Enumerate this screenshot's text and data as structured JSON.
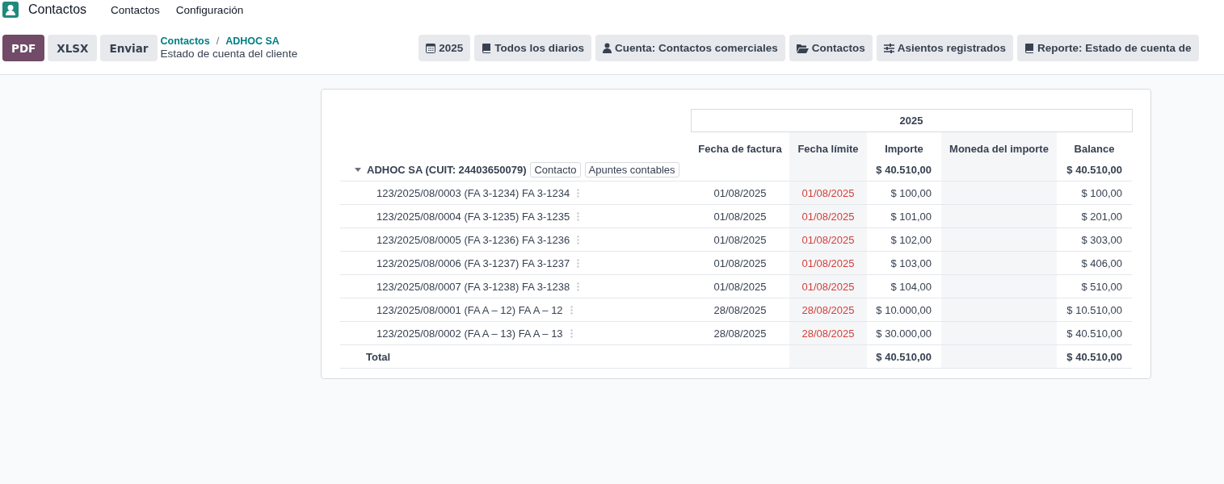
{
  "nav": {
    "app_name": "Contactos",
    "menu": [
      "Contactos",
      "Configuración"
    ]
  },
  "actions": [
    {
      "label": "PDF",
      "kind": "primary"
    },
    {
      "label": "XLSX",
      "kind": "secondary"
    },
    {
      "label": "Enviar",
      "kind": "secondary"
    }
  ],
  "breadcrumb": {
    "links": [
      "Contactos",
      "ADHOC SA"
    ],
    "separator": "/",
    "title": "Estado de cuenta del cliente"
  },
  "filters": [
    {
      "label": "2025",
      "kind": "calendar"
    },
    {
      "label": "Todos los diarios",
      "kind": "book"
    },
    {
      "label": "Cuenta: Contactos comerciales",
      "kind": "user"
    },
    {
      "label": "Contactos",
      "kind": "folder"
    },
    {
      "label": "Asientos registrados",
      "kind": "sliders"
    },
    {
      "label": "Reporte: Estado de cuenta de",
      "kind": "book"
    }
  ],
  "table": {
    "period": "2025",
    "columns": [
      "Fecha de factura",
      "Fecha límite",
      "Importe",
      "Moneda del importe",
      "Balance"
    ],
    "group": {
      "name": "ADHOC SA (CUIT: 24403650079)",
      "expanded": true,
      "buttons": [
        "Contacto",
        "Apuntes contables"
      ],
      "importe": "$ 40.510,00",
      "balance": "$ 40.510,00"
    },
    "rows": [
      {
        "name": "123/2025/08/0003 (FA 3-1234) FA 3-1234",
        "invoice_date": "01/08/2025",
        "due_date": "01/08/2025",
        "overdue": true,
        "amount": "$ 100,00",
        "balance": "$ 100,00"
      },
      {
        "name": "123/2025/08/0004 (FA 3-1235) FA 3-1235",
        "invoice_date": "01/08/2025",
        "due_date": "01/08/2025",
        "overdue": true,
        "amount": "$ 101,00",
        "balance": "$ 201,00"
      },
      {
        "name": "123/2025/08/0005 (FA 3-1236) FA 3-1236",
        "invoice_date": "01/08/2025",
        "due_date": "01/08/2025",
        "overdue": true,
        "amount": "$ 102,00",
        "balance": "$ 303,00"
      },
      {
        "name": "123/2025/08/0006 (FA 3-1237) FA 3-1237",
        "invoice_date": "01/08/2025",
        "due_date": "01/08/2025",
        "overdue": true,
        "amount": "$ 103,00",
        "balance": "$ 406,00"
      },
      {
        "name": "123/2025/08/0007 (FA 3-1238) FA 3-1238",
        "invoice_date": "01/08/2025",
        "due_date": "01/08/2025",
        "overdue": true,
        "amount": "$ 104,00",
        "balance": "$ 510,00"
      },
      {
        "name": "123/2025/08/0001 (FA A – 12) FA A – 12",
        "invoice_date": "28/08/2025",
        "due_date": "28/08/2025",
        "overdue": true,
        "amount": "$ 10.000,00",
        "balance": "$ 10.510,00"
      },
      {
        "name": "123/2025/08/0002 (FA A – 13) FA A – 13",
        "invoice_date": "28/08/2025",
        "due_date": "28/08/2025",
        "overdue": true,
        "amount": "$ 30.000,00",
        "balance": "$ 40.510,00"
      }
    ],
    "total": {
      "label": "Total",
      "importe": "$ 40.510,00",
      "balance": "$ 40.510,00"
    }
  }
}
